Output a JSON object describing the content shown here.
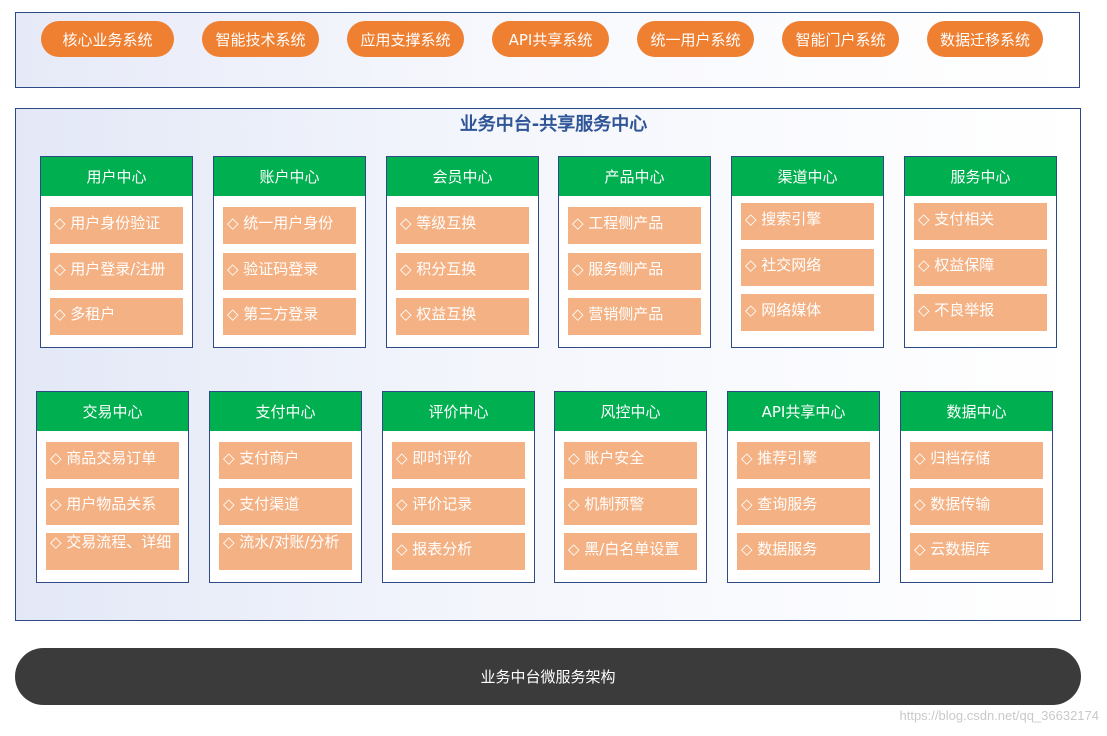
{
  "top_systems": [
    "核心业务系统",
    "智能技术系统",
    "应用支撑系统",
    "API共享系统",
    "统一用户系统",
    "智能门户系统",
    "数据迁移系统"
  ],
  "main_title": "业务中台-共享服务中心",
  "row1": [
    {
      "title": "用户中心",
      "items": [
        "◇ 用户身份验证",
        "◇ 用户登录/注册",
        "◇ 多租户"
      ]
    },
    {
      "title": "账户中心",
      "items": [
        "◇ 统一用户身份",
        "◇ 验证码登录",
        "◇ 第三方登录"
      ]
    },
    {
      "title": "会员中心",
      "items": [
        "◇ 等级互换",
        "◇ 积分互换",
        "◇ 权益互换"
      ]
    },
    {
      "title": "产品中心",
      "items": [
        "◇ 工程侧产品",
        "◇ 服务侧产品",
        "◇ 营销侧产品"
      ]
    },
    {
      "title": "渠道中心",
      "items": [
        "◇ 搜索引擎",
        "◇ 社交网络",
        "◇ 网络媒体"
      ]
    },
    {
      "title": "服务中心",
      "items": [
        "◇ 支付相关",
        "◇ 权益保障",
        "◇ 不良举报"
      ]
    }
  ],
  "row2": [
    {
      "title": "交易中心",
      "items": [
        "◇ 商品交易订单",
        "◇ 用户物品关系",
        "◇ 交易流程、详细"
      ]
    },
    {
      "title": "支付中心",
      "items": [
        "◇ 支付商户",
        "◇ 支付渠道",
        "◇ 流水/对账/分析"
      ]
    },
    {
      "title": "评价中心",
      "items": [
        "◇ 即时评价",
        "◇ 评价记录",
        "◇ 报表分析"
      ]
    },
    {
      "title": "风控中心",
      "items": [
        "◇ 账户安全",
        "◇ 机制预警",
        "◇ 黑/白名单设置"
      ]
    },
    {
      "title": "API共享中心",
      "items": [
        "◇ 推荐引擎",
        "◇ 查询服务",
        "◇ 数据服务"
      ]
    },
    {
      "title": "数据中心",
      "items": [
        "◇ 归档存储",
        "◇ 数据传输",
        "◇ 云数据库"
      ]
    }
  ],
  "bottom_bar": "业务中台微服务架构",
  "watermark": "https://blog.csdn.net/qq_36632174"
}
